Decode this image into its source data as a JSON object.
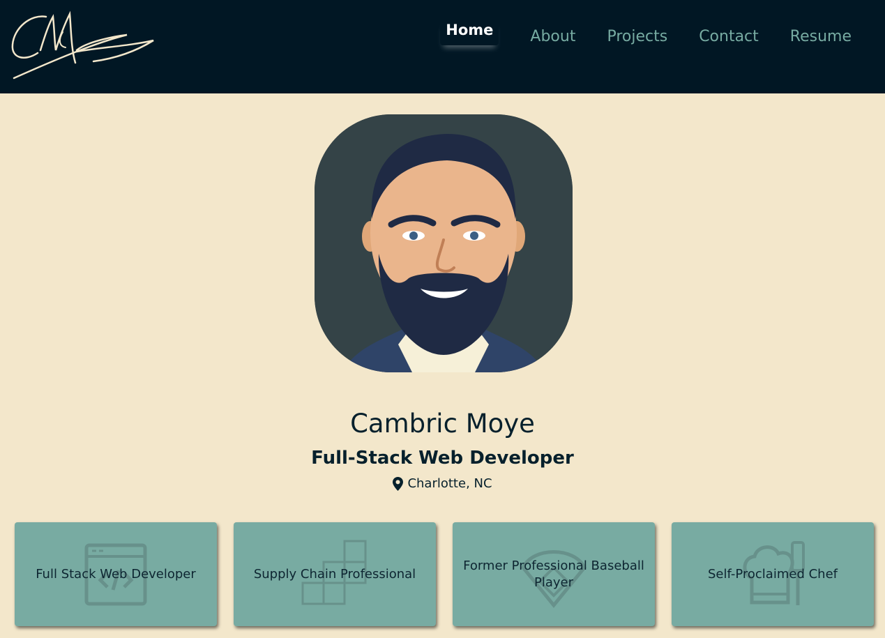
{
  "nav": {
    "logo_text": "CM",
    "links": [
      {
        "label": "Home",
        "active": true
      },
      {
        "label": "About",
        "active": false
      },
      {
        "label": "Projects",
        "active": false
      },
      {
        "label": "Contact",
        "active": false
      },
      {
        "label": "Resume",
        "active": false
      }
    ]
  },
  "profile": {
    "name": "Cambric Moye",
    "title": "Full-Stack Web Developer",
    "location": "Charlotte, NC"
  },
  "cards": [
    {
      "label": "Full Stack Web Developer",
      "icon": "code-window-icon"
    },
    {
      "label": "Supply Chain Professional",
      "icon": "boxes-icon"
    },
    {
      "label": "Former Professional Baseball Player",
      "icon": "baseball-diamond-icon"
    },
    {
      "label": "Self-Proclaimed Chef",
      "icon": "chef-hat-icon"
    }
  ],
  "colors": {
    "nav_bg": "#011724",
    "page_bg": "#f3e7cb",
    "accent": "#78aba2",
    "text_dark": "#06202c"
  }
}
